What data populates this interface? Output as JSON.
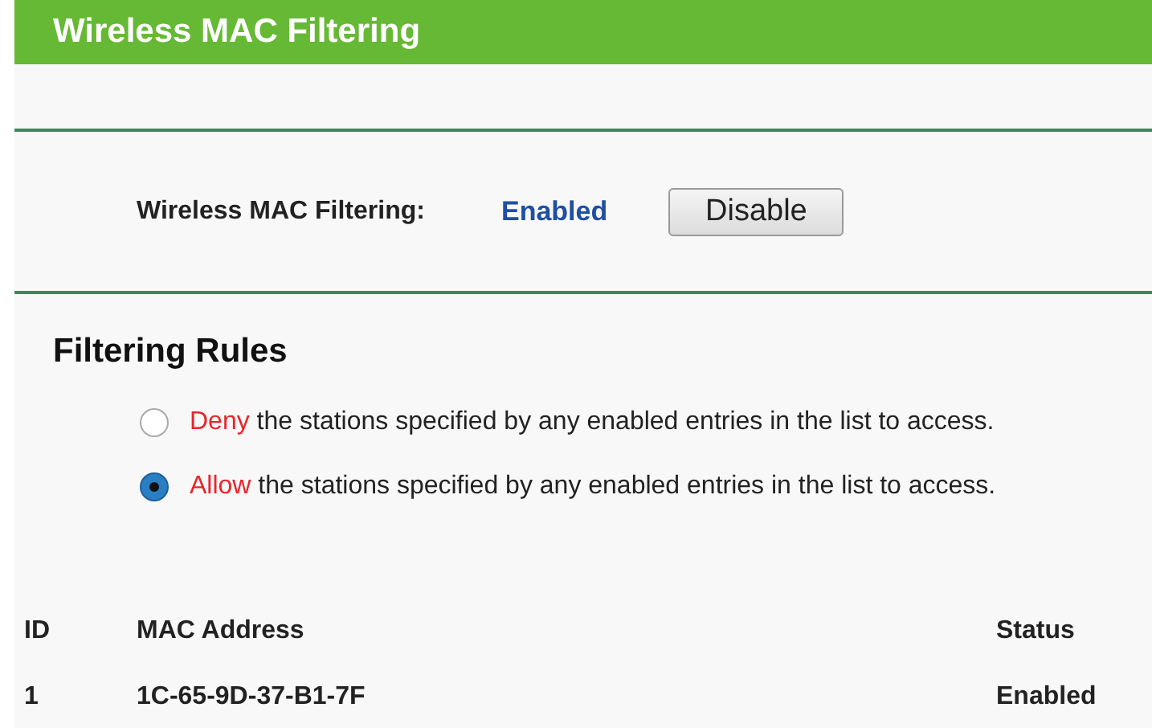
{
  "header": {
    "title": "Wireless MAC Filtering"
  },
  "filtering": {
    "label": "Wireless MAC Filtering:",
    "status": "Enabled",
    "button": "Disable"
  },
  "rules": {
    "title": "Filtering Rules",
    "options": [
      {
        "keyword": "Deny",
        "text": "the stations specified by any enabled entries in the list to access.",
        "selected": false
      },
      {
        "keyword": "Allow",
        "text": "the stations specified by any enabled entries in the list to access.",
        "selected": true
      }
    ]
  },
  "table": {
    "columns": [
      "ID",
      "MAC Address",
      "Status"
    ],
    "rows": [
      [
        "1",
        "1C-65-9D-37-B1-7F",
        "Enabled"
      ]
    ]
  }
}
